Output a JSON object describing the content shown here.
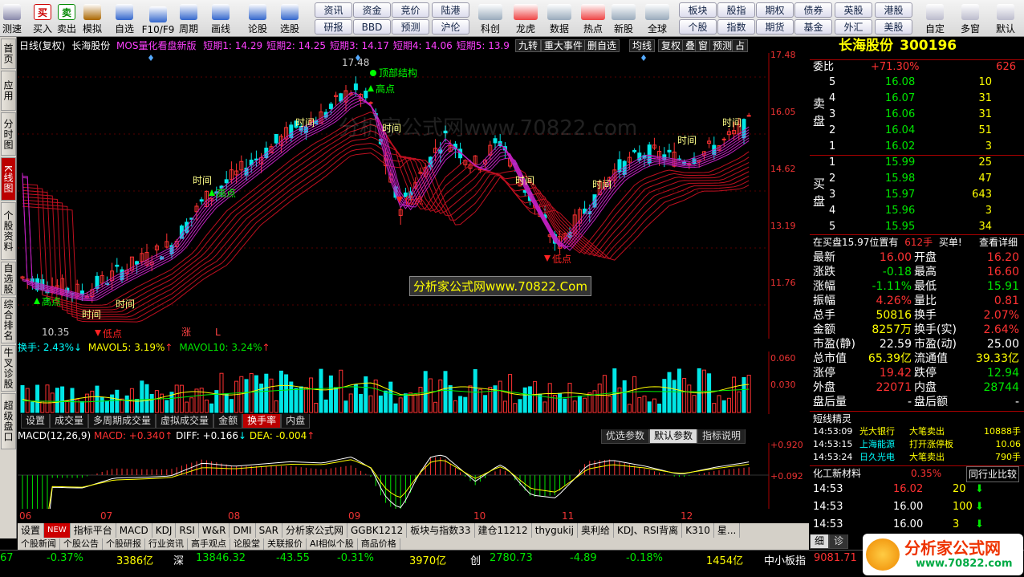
{
  "toolbar": {
    "items": [
      {
        "label": "测速",
        "icon": "speed-icon"
      },
      {
        "label": "买入",
        "icon": "buy-icon"
      },
      {
        "label": "卖出",
        "icon": "sell-icon"
      },
      {
        "label": "模拟",
        "icon": "hammer-icon"
      },
      {
        "label": "自选",
        "icon": "star-icon"
      },
      {
        "label": "F10/F9",
        "icon": "f10-icon"
      },
      {
        "label": "周期",
        "icon": "clock-icon"
      },
      {
        "label": "画线",
        "icon": "pen-icon"
      },
      {
        "label": "论股",
        "icon": "chat-icon"
      },
      {
        "label": "选股",
        "icon": "select-icon"
      }
    ],
    "buttons_row1": [
      "资讯",
      "资金",
      "竞价",
      "陆港"
    ],
    "buttons_row2": [
      "研报",
      "BBD",
      "预测",
      "沪伦"
    ],
    "items2": [
      {
        "label": "科创",
        "icon": "chart-icon"
      },
      {
        "label": "龙虎",
        "icon": "dragon-icon"
      },
      {
        "label": "数据",
        "icon": "pe-icon"
      },
      {
        "label": "热点",
        "icon": "fire-icon"
      },
      {
        "label": "新股",
        "icon": "newstock-icon"
      },
      {
        "label": "全球",
        "icon": "globe-icon"
      }
    ],
    "buttons2_row1": [
      "板块",
      "股指",
      "期权",
      "债券",
      "英股",
      "港股"
    ],
    "buttons2_row2": [
      "个股",
      "指数",
      "期货",
      "基金",
      "外汇",
      "美股"
    ],
    "items3": [
      {
        "label": "自定",
        "icon": "custom-icon"
      },
      {
        "label": "多窗",
        "icon": "window-icon"
      },
      {
        "label": "默认",
        "icon": "default-icon"
      }
    ],
    "buy_glyph": "买",
    "sell_glyph": "卖"
  },
  "sidebar": {
    "tabs": [
      "首页",
      "应用",
      "分时图",
      "K线图",
      "个股资料",
      "自选股",
      "综合排名",
      "牛叉诊股",
      "超级盘口"
    ],
    "active": 3
  },
  "chart": {
    "title": "日线(复权)",
    "stock": "长海股份",
    "indicator": "MOS量化看盘新版",
    "lines": [
      {
        "label": "短期1:",
        "value": "14.29"
      },
      {
        "label": "短期2:",
        "value": "14.25"
      },
      {
        "label": "短期3:",
        "value": "14.17"
      },
      {
        "label": "短期4:",
        "value": "14.06"
      },
      {
        "label": "短期5:",
        "value": "13.9"
      }
    ],
    "header_buttons": [
      "九转",
      "重大事件",
      "删自选",
      "均线",
      "复权",
      "叠",
      "窗",
      "预测",
      "占"
    ],
    "y_labels": [
      "17.48",
      "16.05",
      "14.62",
      "13.19",
      "11.76"
    ],
    "annotations": {
      "high": "17.48",
      "low": "10.35",
      "top_struct": "顶部结构",
      "high_pt": "高点",
      "low_pt": "低点",
      "time": "时间",
      "zhang": "涨",
      "L": "L"
    },
    "watermark": "分析家公式网www.70822.com",
    "watermark2": "分析家公式网www.70822.Com",
    "vol": {
      "label": "换手: 2.43%",
      "mavol5": "MAVOL5: 3.19%",
      "mavol10": "MAVOL10: 3.24%",
      "y1": "0.060",
      "y2": "0.030"
    },
    "vol_tabs": [
      "设置",
      "成交量",
      "多周期成交量",
      "虚拟成交量",
      "金额",
      "换手率",
      "内盘"
    ],
    "vol_tab_active": 5,
    "macd": {
      "label": "MACD(12,26,9)",
      "macd": "MACD: +0.340",
      "diff": "DIFF: +0.166",
      "dea": "DEA: -0.004",
      "y1": "+0.920",
      "y2": "+0.092"
    },
    "macd_buttons": [
      "优选参数",
      "默认参数",
      "指标说明"
    ],
    "months": [
      "06",
      "07",
      "08",
      "09",
      "10",
      "11",
      "12"
    ]
  },
  "bottom_tabs": [
    "设置",
    "NEW",
    "指标平台",
    "MACD",
    "KDJ",
    "RSI",
    "W&R",
    "DMI",
    "SAR",
    "分析家公式网",
    "GGBK1212",
    "板块与指数33",
    "建仓11212",
    "thygukij",
    "奥利给",
    "KDJ、RSI背离",
    "K310",
    "星..."
  ],
  "sub_tabs": [
    "个股新闻",
    "个股公告",
    "个股研报",
    "行业资讯",
    "高手观点",
    "论股堂",
    "关联报价",
    "AI相似个股",
    "商品价格"
  ],
  "quote": {
    "name": "长海股份",
    "code": "300196",
    "weibi_label": "委比",
    "weibi": "+71.30%",
    "weibi_num": "626",
    "sell_label": "卖盘",
    "buy_label": "买盘",
    "sells": [
      [
        "5",
        "16.08",
        "10"
      ],
      [
        "4",
        "16.07",
        "31"
      ],
      [
        "3",
        "16.06",
        "31"
      ],
      [
        "2",
        "16.04",
        "51"
      ],
      [
        "1",
        "16.02",
        "3"
      ]
    ],
    "buys": [
      [
        "1",
        "15.99",
        "25"
      ],
      [
        "2",
        "15.98",
        "47"
      ],
      [
        "3",
        "15.97",
        "643"
      ],
      [
        "4",
        "15.96",
        "3"
      ],
      [
        "5",
        "15.95",
        "34"
      ]
    ],
    "note": "在买盘15.97位置有",
    "note_qty": "612手",
    "note_act": "买单!",
    "note_detail": "查看详细",
    "stats": [
      [
        "最新",
        "16.00",
        "开盘",
        "16.20"
      ],
      [
        "涨跌",
        "-0.18",
        "最高",
        "16.60"
      ],
      [
        "涨幅",
        "-1.11%",
        "最低",
        "15.91"
      ],
      [
        "振幅",
        "4.26%",
        "量比",
        "0.81"
      ],
      [
        "总手",
        "50816",
        "换手",
        "2.07%"
      ],
      [
        "金额",
        "8257万",
        "换手(实)",
        "2.64%"
      ],
      [
        "市盈(静)",
        "22.59",
        "市盈(动)",
        "25.00"
      ],
      [
        "总市值",
        "65.39亿",
        "流通值",
        "39.33亿"
      ],
      [
        "涨停",
        "19.42",
        "跌停",
        "12.94"
      ],
      [
        "外盘",
        "22071",
        "内盘",
        "28744"
      ],
      [
        "盘后量",
        "-",
        "盘后额",
        "-"
      ]
    ],
    "elf_title": "短线精灵",
    "elf": [
      [
        "14:53:09",
        "光大银行",
        "大笔卖出",
        "10888手"
      ],
      [
        "14:53:15",
        "上海能源",
        "打开涨停板",
        "10.06"
      ],
      [
        "14:53:24",
        "日久光电",
        "大笔卖出",
        "790手"
      ]
    ],
    "industry": "化工新材料",
    "industry_pct": "0.35%",
    "industry_btn": "同行业比较",
    "ticks": [
      [
        "14:53",
        "16.02",
        "20"
      ],
      [
        "14:53",
        "16.00",
        "100"
      ],
      [
        "14:53",
        "16.00",
        "3"
      ]
    ],
    "tabs": [
      "细",
      "诊"
    ]
  },
  "status": {
    "items": [
      "67",
      "-0.37%",
      "3386亿",
      "深",
      "13846.32",
      "-43.55",
      "-0.31%",
      "3970亿",
      "创",
      "2780.73",
      "-4.89",
      "-0.18%",
      "1454亿",
      "中小板指",
      "9081.71"
    ]
  },
  "logo": "分析家公式网",
  "logo_url": "www.70822.com"
}
